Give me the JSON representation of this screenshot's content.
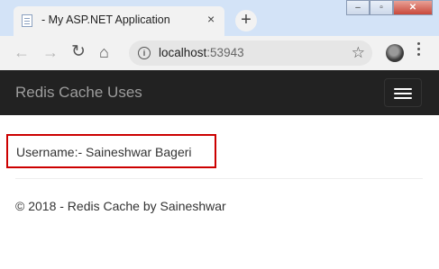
{
  "browser": {
    "tab_title": "- My ASP.NET Application",
    "tab_close": "×",
    "new_tab": "+",
    "window_controls": {
      "minimize": "–",
      "maximize": "▫",
      "close": "✕"
    },
    "url_host": "localhost",
    "url_port": ":53943",
    "icons": [
      "back-arrow-icon",
      "forward-arrow-icon",
      "reload-icon",
      "home-icon",
      "info-icon",
      "star-icon",
      "profile-avatar",
      "menu-icon"
    ]
  },
  "navbar": {
    "brand": "Redis Cache Uses",
    "background": "#222222",
    "brand_color": "#9d9d9d"
  },
  "main": {
    "username_text": "Username:- Saineshwar Bageri",
    "highlight_color": "#cc0000"
  },
  "footer": {
    "text": "© 2018 - Redis Cache by Saineshwar"
  }
}
